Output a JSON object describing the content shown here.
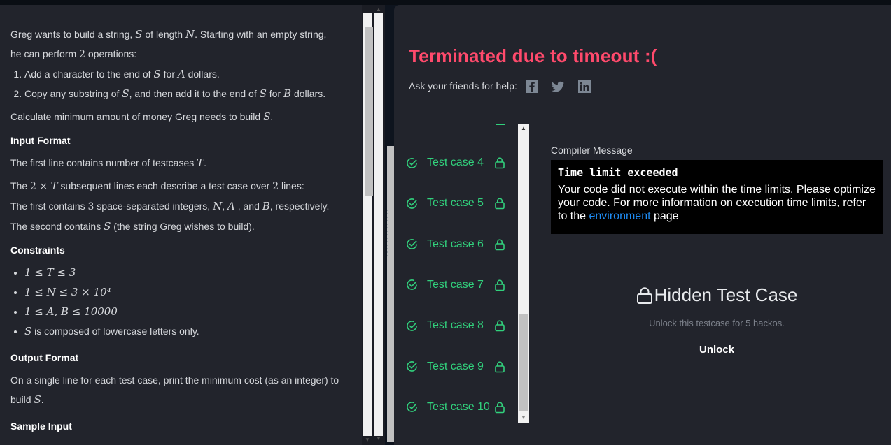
{
  "problem": {
    "intro_1": "Greg wants to build a string, ",
    "intro_S": "S",
    "intro_2": " of length ",
    "intro_N": "N",
    "intro_3": ". Starting with an empty string,",
    "intro_line2a": "he can perform ",
    "intro_two": "2",
    "intro_line2b": " operations:",
    "op1_a": "Add a character to the end of ",
    "op1_S": "S",
    "op1_b": " for ",
    "op1_A": "A",
    "op1_c": " dollars.",
    "op2_a": "Copy any substring of ",
    "op2_S": "S",
    "op2_b": ", and then add it to the end of ",
    "op2_S2": "S",
    "op2_c": " for ",
    "op2_B": "B",
    "op2_d": " dollars.",
    "calc_a": "Calculate minimum amount of money Greg needs to build ",
    "calc_S": "S",
    "calc_b": ".",
    "input_heading": "Input Format",
    "input_1a": "The first line contains number of testcases ",
    "input_1T": "T",
    "input_1b": ".",
    "input_2a": "The ",
    "input_2m": "2 × ",
    "input_2T": "T",
    "input_2b": " subsequent lines each describe a test case over ",
    "input_2two": "2",
    "input_2c": " lines:",
    "input_3a": "The first contains ",
    "input_3three": "3",
    "input_3b": " space-separated integers, ",
    "input_3N": "N",
    "input_3c": ", ",
    "input_3A": "A",
    "input_3d": " , and ",
    "input_3B": "B",
    "input_3e": ", respectively.",
    "input_4a": "The second contains ",
    "input_4S": "S",
    "input_4b": " (the string Greg wishes to build).",
    "constraints_heading": "Constraints",
    "c1": "1 ≤ T ≤ 3",
    "c2": "1 ≤ N ≤ 3 × 10⁴",
    "c3": "1 ≤ A, B ≤ 10000",
    "c4_S": "S",
    "c4_b": " is composed of lowercase letters only.",
    "output_heading": "Output Format",
    "output_a": "On a single line for each test case, print the minimum cost (as an integer) to",
    "output_b": "build ",
    "output_S": "S",
    "output_c": ".",
    "sample_heading": "Sample Input"
  },
  "result": {
    "title": "Terminated due to timeout :(",
    "share_label": "Ask your friends for help:",
    "share_icons": [
      "facebook-icon",
      "twitter-icon",
      "linkedin-icon"
    ],
    "test_cases": [
      {
        "label": "Test case 4"
      },
      {
        "label": "Test case 5"
      },
      {
        "label": "Test case 6"
      },
      {
        "label": "Test case 7"
      },
      {
        "label": "Test case 8"
      },
      {
        "label": "Test case 9"
      },
      {
        "label": "Test case 10"
      }
    ],
    "compiler_label": "Compiler Message",
    "compiler_head": "Time limit exceeded",
    "compiler_body_a": "Your code did not execute within the time limits. Please optimize your code. For more information on execution time limits, refer to the ",
    "compiler_link": "environment",
    "compiler_body_b": " page",
    "hidden_title": "Hidden Test Case",
    "unlock_sub": "Unlock this testcase for 5 hackos.",
    "unlock_button": "Unlock"
  },
  "colors": {
    "error_title": "#ff4a6c",
    "success_green": "#31d07c",
    "link_blue": "#1f8cf3",
    "panel_bg": "#22242c"
  }
}
